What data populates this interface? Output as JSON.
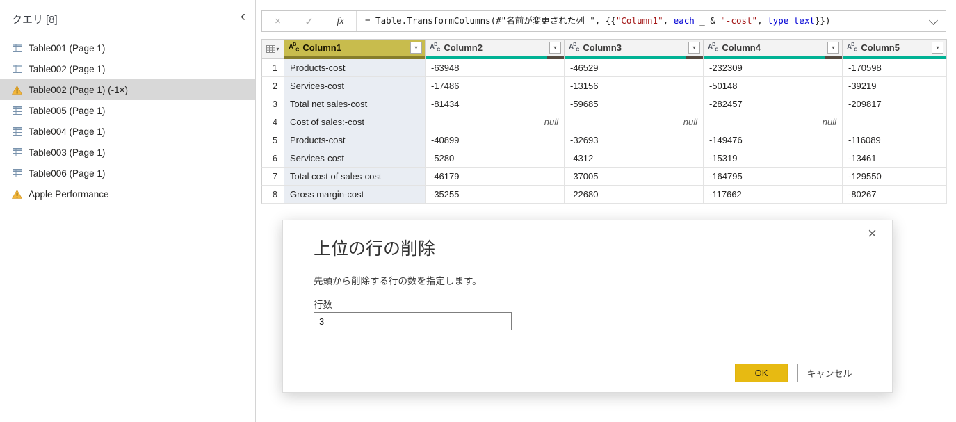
{
  "sidebar": {
    "title": "クエリ",
    "count": "[8]",
    "items": [
      {
        "label": "Table001 (Page 1)",
        "icon": "table",
        "selected": false
      },
      {
        "label": "Table002 (Page 1)",
        "icon": "table",
        "selected": false
      },
      {
        "label": "Table002 (Page 1) (-1×)",
        "icon": "warning",
        "selected": true
      },
      {
        "label": "Table005 (Page 1)",
        "icon": "table",
        "selected": false
      },
      {
        "label": "Table004 (Page 1)",
        "icon": "table",
        "selected": false
      },
      {
        "label": "Table003 (Page 1)",
        "icon": "table",
        "selected": false
      },
      {
        "label": "Table006 (Page 1)",
        "icon": "table",
        "selected": false
      },
      {
        "label": "Apple Performance",
        "icon": "warning",
        "selected": false
      }
    ]
  },
  "formula_bar": {
    "formula_plain": "= Table.TransformColumns(#\"名前が変更された列 \", {{\"Column1\", each _ & \"-cost\", type text}})",
    "segments": [
      {
        "text": "= Table.TransformColumns(#\"名前が変更された列 \", {{",
        "color": "#1e1e1e"
      },
      {
        "text": "\"Column1\"",
        "color": "#a31515"
      },
      {
        "text": ", ",
        "color": "#1e1e1e"
      },
      {
        "text": "each",
        "color": "#0000d4"
      },
      {
        "text": " _ & ",
        "color": "#1e1e1e"
      },
      {
        "text": "\"-cost\"",
        "color": "#a31515"
      },
      {
        "text": ", ",
        "color": "#1e1e1e"
      },
      {
        "text": "type text",
        "color": "#0000d4"
      },
      {
        "text": "}})",
        "color": "#1e1e1e"
      }
    ]
  },
  "table": {
    "type_label": "ABC",
    "columns": [
      {
        "name": "Column1",
        "selected": true,
        "bar_color": "#867d2b",
        "empty_fraction": 0
      },
      {
        "name": "Column2",
        "selected": false,
        "bar_color": "#00b294",
        "empty_fraction": 0.12
      },
      {
        "name": "Column3",
        "selected": false,
        "bar_color": "#00b294",
        "empty_fraction": 0.12
      },
      {
        "name": "Column4",
        "selected": false,
        "bar_color": "#00b294",
        "empty_fraction": 0.12
      },
      {
        "name": "Column5",
        "selected": false,
        "bar_color": "#00b294",
        "empty_fraction": 0
      }
    ],
    "rows": [
      {
        "num": "1",
        "cells": [
          "Products-cost",
          "-63948",
          "-46529",
          "-232309",
          "-170598"
        ]
      },
      {
        "num": "2",
        "cells": [
          "Services-cost",
          "-17486",
          "-13156",
          "-50148",
          "-39219"
        ]
      },
      {
        "num": "3",
        "cells": [
          "Total net sales-cost",
          "-81434",
          "-59685",
          "-282457",
          "-209817"
        ]
      },
      {
        "num": "4",
        "cells": [
          "Cost of sales:-cost",
          "null",
          "null",
          "null",
          ""
        ]
      },
      {
        "num": "5",
        "cells": [
          "Products-cost",
          "-40899",
          "-32693",
          "-149476",
          "-116089"
        ]
      },
      {
        "num": "6",
        "cells": [
          "Services-cost",
          "-5280",
          "-4312",
          "-15319",
          "-13461"
        ]
      },
      {
        "num": "7",
        "cells": [
          "Total cost of sales-cost",
          "-46179",
          "-37005",
          "-164795",
          "-129550"
        ]
      },
      {
        "num": "8",
        "cells": [
          "Gross margin-cost",
          "-35255",
          "-22680",
          "-117662",
          "-80267"
        ]
      }
    ]
  },
  "dialog": {
    "title": "上位の行の削除",
    "description": "先頭から削除する行の数を指定します。",
    "field_label": "行数",
    "field_value": "3",
    "ok_label": "OK",
    "cancel_label": "キャンセル"
  },
  "icons": {
    "collapse_pane": "‹",
    "cancel_formula": "×",
    "commit_formula": "✓",
    "fx": "fx",
    "filter_dropdown": "▾",
    "dialog_close": "×"
  },
  "colors": {
    "accent_yellow": "#e7ba12",
    "quality_teal": "#00b294",
    "quality_empty": "#554b41",
    "selected_column_header": "#c8bc4d",
    "selected_column_cell": "#e9edf3",
    "sidebar_selected": "#d8d8d8",
    "string_literal": "#a31515",
    "keyword": "#0000d4"
  }
}
